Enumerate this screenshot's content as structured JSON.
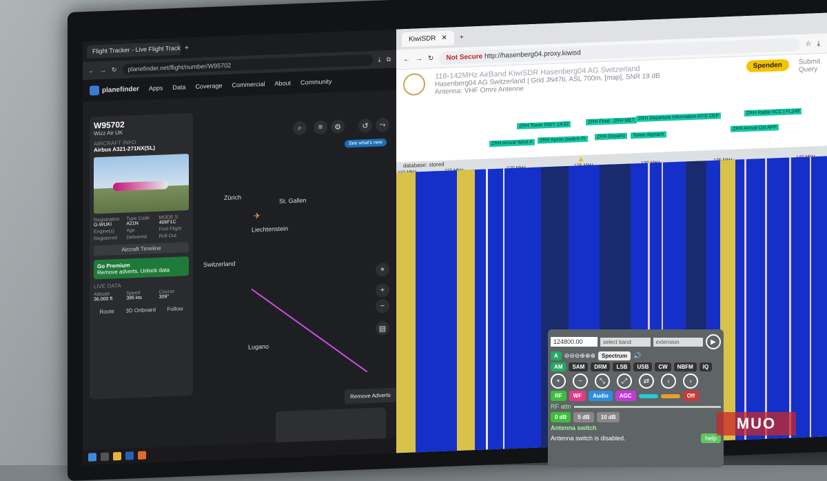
{
  "left": {
    "tab_title": "Flight Tracker - Live Flight Track",
    "url": "planefinder.net/flight/number/W95702",
    "nav": {
      "brand": "planefinder",
      "items": [
        "Apps",
        "Data",
        "Coverage",
        "Commercial",
        "About",
        "Community"
      ]
    },
    "panel": {
      "flight": "W95702",
      "airline": "Wizz Air UK",
      "section": "AIRCRAFT INFO",
      "aircraft": "Airbus A321-271NX(SL)",
      "fields": [
        {
          "k": "Registration",
          "v": "G-WUKI"
        },
        {
          "k": "Type Code",
          "v": "A21N"
        },
        {
          "k": "MODE S",
          "v": "406F1C"
        },
        {
          "k": "Engine(s)",
          "v": ""
        },
        {
          "k": "Age",
          "v": ""
        },
        {
          "k": "First Flight",
          "v": ""
        },
        {
          "k": "Registered",
          "v": ""
        },
        {
          "k": "Delivered",
          "v": ""
        },
        {
          "k": "Roll Out",
          "v": ""
        }
      ],
      "timeline": "Aircraft Timeline",
      "premium_title": "Go Premium",
      "premium_sub": "Remove adverts. Unlock data",
      "live_title": "LIVE DATA",
      "live": [
        {
          "k": "Altitude",
          "v": "36,000 ft"
        },
        {
          "k": "Speed",
          "v": "395 kts"
        },
        {
          "k": "Course",
          "v": "309°"
        }
      ],
      "footer": [
        "Route",
        "3D Onboard",
        "Follow"
      ]
    },
    "map_labels": [
      "Liechtenstein",
      "Switzerland",
      "St. Gallen",
      "Zürich",
      "Lugano"
    ],
    "see_whats_new": "See what's new",
    "remove_adverts": "Remove Adverts"
  },
  "right": {
    "tab_title": "KiwiSDR",
    "not_secure": "Not Secure",
    "url": "http://hasenberg04.proxy.kiwisd",
    "title": "118-142MHz AirBand KiwiSDR Hasenberg04 AG Switzerland",
    "subtitle": "Hasenberg04 AG Switzerland | Grid JN47ti, ASL 700m, [map], SNR 19 dB",
    "antenna": "Antenna: VHF Omni Antenne",
    "spenden": "Spenden",
    "submit": "Submit",
    "query": "Query",
    "db": "database: stored",
    "labels": [
      "ZRH Tower RWY 14/32",
      "ZRH Final",
      "ZRH MET",
      "ZRH Departure Information ATIS DEP",
      "ZRH Radar ACC | FL249",
      "ZRH Arrival West A",
      "ZRH Apron (switch Pr",
      "ZRH Departu",
      "Tower Alpnach",
      "ZRH Arrival Ost APP"
    ],
    "ticks": [
      "110 MHz",
      "115 MHz",
      "120 MHz",
      "125 MHz",
      "130 MHz",
      "135 MHz",
      "140 MHz"
    ],
    "control": {
      "freq": "124800.00",
      "band": "select band",
      "ext": "extension",
      "modes": [
        "AM",
        "SAM",
        "DRM",
        "LSB",
        "USB",
        "CW",
        "NBFM",
        "IQ"
      ],
      "spectrum": "Spectrum",
      "tabs": [
        "RF",
        "WF",
        "Audio",
        "AGC",
        "",
        "",
        "Off"
      ],
      "rf_attn": "RF attn",
      "attn": [
        "0 dB",
        "5 dB",
        "10 dB"
      ],
      "antenna_title": "Antenna switch",
      "antenna_status": "Antenna switch is disabled.",
      "help": "help"
    }
  },
  "watermark": "MUO"
}
